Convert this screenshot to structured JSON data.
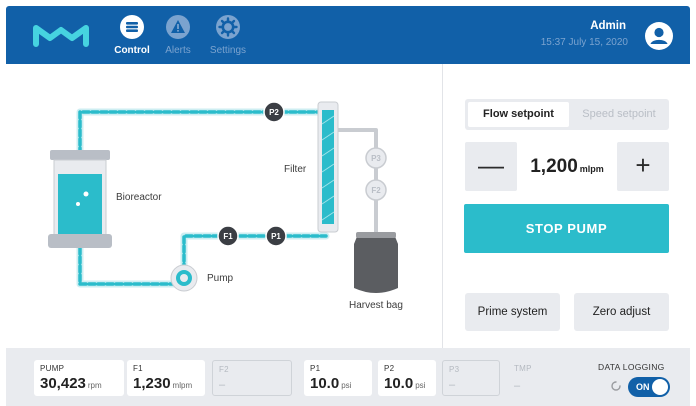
{
  "colors": {
    "header_bg": "#1160a8",
    "accent": "#2bbccb",
    "tube": "#2bbccb",
    "panel_bg": "#e9ebef"
  },
  "header": {
    "logo": "m-logo-icon",
    "nav": [
      {
        "label": "Control",
        "icon": "control-icon",
        "active": true
      },
      {
        "label": "Alerts",
        "icon": "alert-icon",
        "active": false
      },
      {
        "label": "Settings",
        "icon": "gear-icon",
        "active": false
      }
    ],
    "user": {
      "name": "Admin",
      "timestamp": "15:37 July 15, 2020",
      "icon": "user-avatar-icon"
    }
  },
  "diagram": {
    "labels": {
      "bioreactor": "Bioreactor",
      "filter": "Filter",
      "pump": "Pump",
      "harvest_bag": "Harvest bag"
    },
    "sensors": {
      "p2": "P2",
      "f1": "F1",
      "p1": "P1",
      "p3": "P3",
      "f2": "F2"
    }
  },
  "control": {
    "tabs": {
      "flow": "Flow setpoint",
      "speed": "Speed setpoint"
    },
    "setpoint": {
      "value": "1,200",
      "unit": "mlpm",
      "minus": "—",
      "plus": "+"
    },
    "stop_label": "STOP PUMP",
    "prime_label": "Prime system",
    "zero_label": "Zero adjust"
  },
  "readings": {
    "pump": {
      "label": "PUMP",
      "value": "30,423",
      "unit": "rpm"
    },
    "f1": {
      "label": "F1",
      "value": "1,230",
      "unit": "mlpm"
    },
    "f2": {
      "label": "F2",
      "value": "–"
    },
    "p1": {
      "label": "P1",
      "value": "10.0",
      "unit": "psi"
    },
    "p2": {
      "label": "P2",
      "value": "10.0",
      "unit": "psi"
    },
    "p3": {
      "label": "P3",
      "value": "–"
    },
    "tmp": {
      "label": "TMP",
      "value": "–"
    }
  },
  "logging": {
    "label": "DATA LOGGING",
    "toggle": "ON"
  }
}
